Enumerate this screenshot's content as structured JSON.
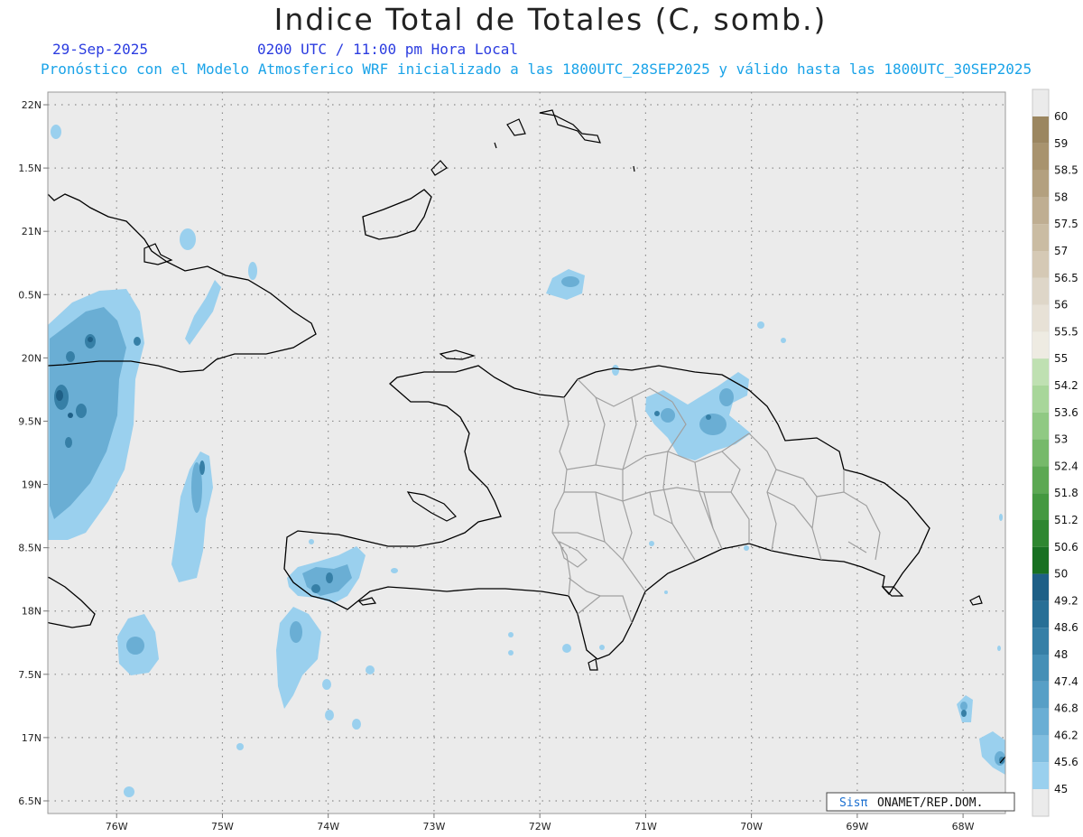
{
  "header": {
    "title": "Indice Total de Totales (C, somb.)",
    "date": "29-Sep-2025",
    "time": "0200 UTC / 11:00 pm Hora Local",
    "description": "Pronóstico con el Modelo Atmosferico WRF inicializado a las 1800UTC_28SEP2025 y válido hasta las  1800UTC_30SEP2025"
  },
  "map": {
    "lon_range": [
      -76.65,
      -67.6
    ],
    "lat_range": [
      16.4,
      22.1
    ],
    "background_color": "#ebebeb",
    "coast_color": "#000000",
    "province_color": "#a0a0a0",
    "lon_ticks": [
      {
        "value": -76,
        "label": "76W"
      },
      {
        "value": -75,
        "label": "75W"
      },
      {
        "value": -74,
        "label": "74W"
      },
      {
        "value": -73,
        "label": "73W"
      },
      {
        "value": -72,
        "label": "72W"
      },
      {
        "value": -71,
        "label": "71W"
      },
      {
        "value": -70,
        "label": "70W"
      },
      {
        "value": -69,
        "label": "69W"
      },
      {
        "value": -68,
        "label": "68W"
      }
    ],
    "lat_ticks": [
      {
        "value": 22,
        "label": "22N"
      },
      {
        "value": 21.5,
        "label": "1.5N"
      },
      {
        "value": 21,
        "label": "21N"
      },
      {
        "value": 20.5,
        "label": "0.5N"
      },
      {
        "value": 20,
        "label": "20N"
      },
      {
        "value": 19.5,
        "label": "9.5N"
      },
      {
        "value": 19,
        "label": "19N"
      },
      {
        "value": 18.5,
        "label": "8.5N"
      },
      {
        "value": 18,
        "label": "18N"
      },
      {
        "value": 17.5,
        "label": "7.5N"
      },
      {
        "value": 17,
        "label": "17N"
      },
      {
        "value": 16.5,
        "label": "6.5N"
      }
    ]
  },
  "legend": {
    "top_label": "60",
    "bins": [
      {
        "label": "59",
        "color": "#9b8660"
      },
      {
        "label": "58.5",
        "color": "#a8936e"
      },
      {
        "label": "58",
        "color": "#b3a07f"
      },
      {
        "label": "57.5",
        "color": "#bfae92"
      },
      {
        "label": "57",
        "color": "#cabca3"
      },
      {
        "label": "56.5",
        "color": "#d5c9b5"
      },
      {
        "label": "56",
        "color": "#ded6c8"
      },
      {
        "label": "55.5",
        "color": "#e7e1d6"
      },
      {
        "label": "55",
        "color": "#eeebe2"
      },
      {
        "label": "54.2",
        "color": "#bfe0b2"
      },
      {
        "label": "53.6",
        "color": "#a8d69a"
      },
      {
        "label": "53",
        "color": "#90c983"
      },
      {
        "label": "52.4",
        "color": "#76b96a"
      },
      {
        "label": "51.8",
        "color": "#5ca853"
      },
      {
        "label": "51.2",
        "color": "#449840"
      },
      {
        "label": "50.6",
        "color": "#2e8630"
      },
      {
        "label": "50",
        "color": "#187022"
      },
      {
        "label": "49.2",
        "color": "#1e5f86"
      },
      {
        "label": "48.6",
        "color": "#286f96"
      },
      {
        "label": "48",
        "color": "#367fa6"
      },
      {
        "label": "47.4",
        "color": "#458fb6"
      },
      {
        "label": "46.8",
        "color": "#579fc6"
      },
      {
        "label": "46.2",
        "color": "#6aaed4"
      },
      {
        "label": "45.6",
        "color": "#80bee0"
      },
      {
        "label": "45",
        "color": "#9ad0ee"
      }
    ]
  },
  "credit": {
    "logo": "Sisπ",
    "text": " ONAMET/REP.DOM."
  }
}
